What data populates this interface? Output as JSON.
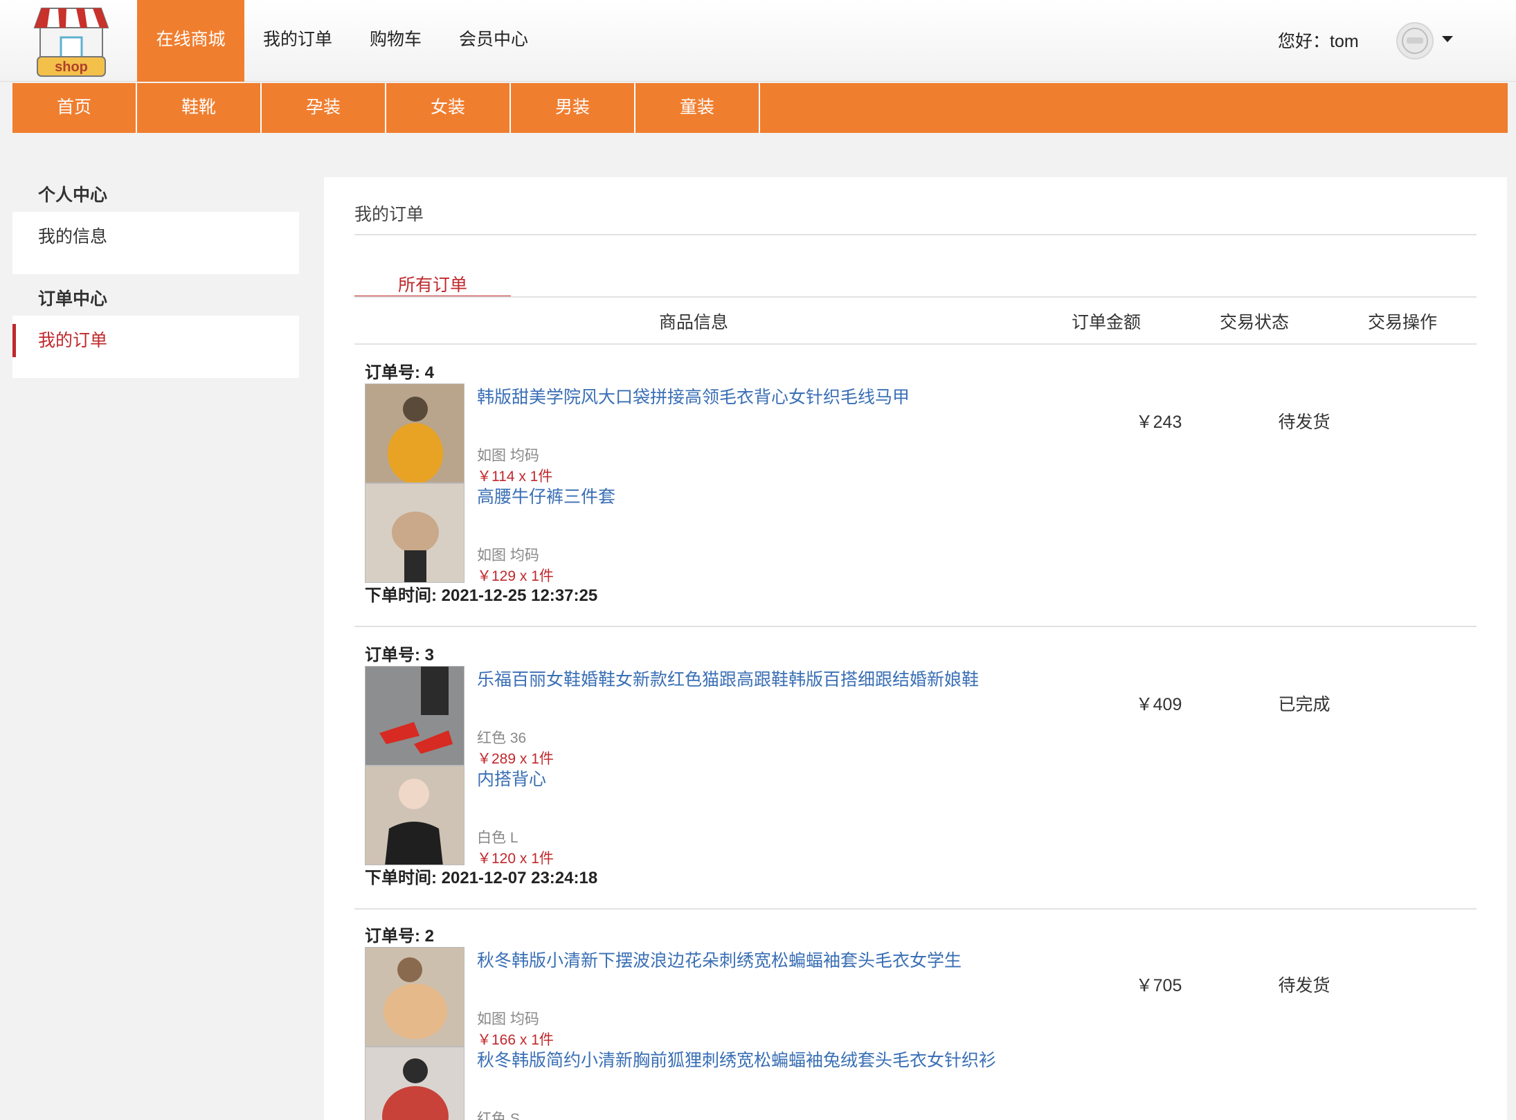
{
  "header": {
    "logo_text": "shop",
    "nav": [
      "在线商城",
      "我的订单",
      "购物车",
      "会员中心"
    ],
    "greeting": "您好：tom"
  },
  "categories": [
    "首页",
    "鞋靴",
    "孕装",
    "女装",
    "男装",
    "童装"
  ],
  "sidebar": {
    "personal_heading": "个人中心",
    "personal_items": [
      "我的信息"
    ],
    "order_heading": "订单中心",
    "order_items": [
      "我的订单"
    ]
  },
  "main": {
    "title": "我的订单",
    "tab_all": "所有订单",
    "columns": [
      "商品信息",
      "订单金额",
      "交易状态",
      "交易操作"
    ]
  },
  "orders": [
    {
      "number": "订单号: 4",
      "amount": "￥243",
      "status": "待发货",
      "time": "下单时间: 2021-12-25 12:37:25",
      "items": [
        {
          "name": "韩版甜美学院风大口袋拼接高领毛衣背心女针织毛线马甲",
          "spec": "如图 均码",
          "price": "￥114 x 1件",
          "thumb_colors": [
            "#b9a48c",
            "#e9a324",
            "#5a4a3a"
          ]
        },
        {
          "name": "高腰牛仔裤三件套",
          "spec": "如图 均码",
          "price": "￥129 x 1件",
          "thumb_colors": [
            "#d8cfc4",
            "#c9a98a",
            "#2a2a2a"
          ]
        }
      ]
    },
    {
      "number": "订单号: 3",
      "amount": "￥409",
      "status": "已完成",
      "time": "下单时间: 2021-12-07 23:24:18",
      "items": [
        {
          "name": "乐福百丽女鞋婚鞋女新款红色猫跟高跟鞋韩版百搭细跟结婚新娘鞋",
          "spec": "红色 36",
          "price": "￥289 x 1件",
          "thumb_colors": [
            "#8d8e90",
            "#d62a22",
            "#2b2b2b"
          ]
        },
        {
          "name": "内搭背心",
          "spec": "白色 L",
          "price": "￥120 x 1件",
          "thumb_colors": [
            "#cfc3b5",
            "#f0d8c8",
            "#1f1f1f"
          ]
        }
      ]
    },
    {
      "number": "订单号: 2",
      "amount": "￥705",
      "status": "待发货",
      "time": "",
      "items": [
        {
          "name": "秋冬韩版小清新下摆波浪边花朵刺绣宽松蝙蝠袖套头毛衣女学生",
          "spec": "如图 均码",
          "price": "￥166 x 1件",
          "thumb_colors": [
            "#cdbfae",
            "#e6b98a",
            "#8a6a4f"
          ]
        },
        {
          "name": "秋冬韩版简约小清新胸前狐狸刺绣宽松蝙蝠袖兔绒套头毛衣女针织衫",
          "spec": "红色 S",
          "price": "",
          "thumb_colors": [
            "#d9d4cf",
            "#c8423a",
            "#2c2c2c"
          ]
        }
      ]
    }
  ]
}
